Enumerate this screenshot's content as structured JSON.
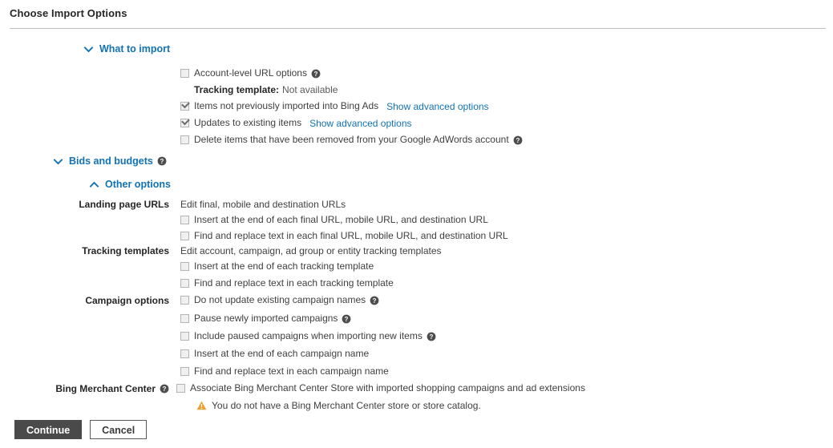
{
  "header": {
    "title": "Choose Import Options"
  },
  "sections": {
    "what_to_import": {
      "label": "What to import",
      "chevron": "chevron-down-icon",
      "expanded": true
    },
    "bids_and_budgets": {
      "label": "Bids and budgets",
      "chevron": "chevron-down-icon",
      "help": "help-icon",
      "expanded": false
    },
    "other_options": {
      "label": "Other options",
      "chevron": "chevron-up-icon",
      "expanded": true
    }
  },
  "what_to_import_items": [
    {
      "label": "Account-level URL options",
      "checked": false,
      "help": true,
      "link": null
    },
    {
      "label": "Items not previously imported into Bing Ads",
      "checked": true,
      "help": false,
      "link": "Show advanced options"
    },
    {
      "label": "Updates to existing items",
      "checked": true,
      "help": false,
      "link": "Show advanced options"
    },
    {
      "label": "Delete items that have been removed from your Google AdWords account",
      "checked": false,
      "help": true,
      "link": null
    }
  ],
  "tracking_template_info": {
    "key": "Tracking template:",
    "value": "Not available"
  },
  "other_options_groups": {
    "landing_page_urls": {
      "label": "Landing page URLs",
      "description": "Edit final, mobile and destination URLs",
      "items": [
        {
          "label": "Insert at the end of each final URL, mobile URL, and destination URL",
          "checked": false,
          "help": false
        },
        {
          "label": "Find and replace text in each final URL, mobile URL, and destination URL",
          "checked": false,
          "help": false
        }
      ]
    },
    "tracking_templates": {
      "label": "Tracking templates",
      "description": "Edit account, campaign, ad group or entity tracking templates",
      "items": [
        {
          "label": "Insert at the end of each tracking template",
          "checked": false,
          "help": false
        },
        {
          "label": "Find and replace text in each tracking template",
          "checked": false,
          "help": false
        }
      ]
    },
    "campaign_options": {
      "label": "Campaign options",
      "description": null,
      "items": [
        {
          "label": "Do not update existing campaign names",
          "checked": false,
          "help": true
        },
        {
          "label": "Pause newly imported campaigns",
          "checked": false,
          "help": true
        },
        {
          "label": "Include paused campaigns when importing new items",
          "checked": false,
          "help": true
        },
        {
          "label": "Insert at the end of each campaign name",
          "checked": false,
          "help": false
        },
        {
          "label": "Find and replace text in each campaign name",
          "checked": false,
          "help": false
        }
      ]
    },
    "bing_merchant_center": {
      "label": "Bing Merchant Center",
      "help": true,
      "description": null,
      "items": [
        {
          "label": "Associate Bing Merchant Center Store with imported shopping campaigns and ad extensions",
          "checked": false,
          "help": false
        }
      ],
      "warning": "You do not have a Bing Merchant Center store or store catalog."
    }
  },
  "footer": {
    "continue_label": "Continue",
    "cancel_label": "Cancel"
  },
  "colors": {
    "link": "#1272b4",
    "warning": "#f0a030",
    "primary_button_bg": "#4a4a4a",
    "text": "#404040"
  }
}
